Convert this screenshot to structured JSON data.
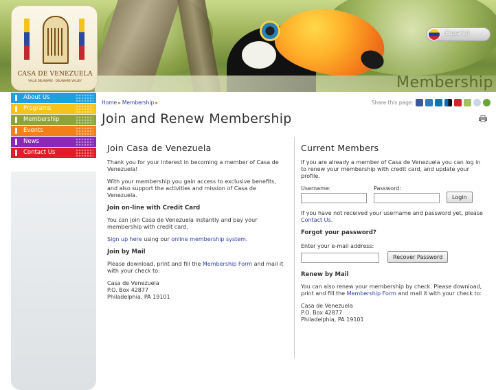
{
  "header": {
    "logo_name": "CASA DE VENEZUELA",
    "logo_sub": "VALLE DELAWARE · DELAWARE VALLEY",
    "section_title": "Membership",
    "language_label": "Español"
  },
  "nav": {
    "items": [
      {
        "label": "About Us",
        "color": "#1ea0e0"
      },
      {
        "label": "Programs",
        "color": "#f7c21a"
      },
      {
        "label": "Membership",
        "color": "#8ea33a"
      },
      {
        "label": "Events",
        "color": "#f2801a"
      },
      {
        "label": "News",
        "color": "#8a28b8"
      },
      {
        "label": "Contact Us",
        "color": "#e01c2a"
      }
    ]
  },
  "breadcrumb": {
    "home": "Home",
    "current": "Membership"
  },
  "share": {
    "label": "Share this page:"
  },
  "page_title": "Join and Renew Membership",
  "left": {
    "heading": "Join Casa de Venezuela",
    "p1": "Thank you for your interest in becoming a member of Casa de Venezuela!",
    "p2": "With your membership you gain access to exclusive benefits, and also support the activities and mission of Casa de Venezuela.",
    "online_heading": "Join on-line with Credit Card",
    "p3": "You can join Casa de Venezuela instantly and pay your membership with credit card.",
    "signup_link": "Sign up here",
    "signup_mid": " using our ",
    "online_system_link": "online membership system",
    "signup_end": ".",
    "mail_heading": "Join by Mail",
    "mail_text": "Please download, print and fill the ",
    "form_link": "Membership Form",
    "mail_text_end": " and mail it with your check to:",
    "address_1": "Casa de Venezuela",
    "address_2": "P.O. Box 42877",
    "address_3": "Philadelphia, PA 19101"
  },
  "right": {
    "heading": "Current Members",
    "intro": "If you are already a member of Casa de Venezuela you can log in to renew your membership with credit card, and update your profile.",
    "username_label": "Username:",
    "password_label": "Password:",
    "login_button": "Login",
    "no_creds": "If you have not received your username and password yet, please ",
    "contact_link": "Contact Us",
    "no_creds_end": ".",
    "forgot_heading": "Forgot your password?",
    "email_label": "Enter your e-mail address:",
    "recover_button": "Recover Password",
    "renew_heading": "Renew by Mail",
    "renew_text": "You can also renew your membership by check. Please download, print and fill the ",
    "form_link": "Membership Form",
    "renew_text_end": " and mail it with your check to:",
    "address_1": "Casa de Venezuela",
    "address_2": "P.O. Box 42877",
    "address_3": "Philadelphia, PA 19101"
  }
}
